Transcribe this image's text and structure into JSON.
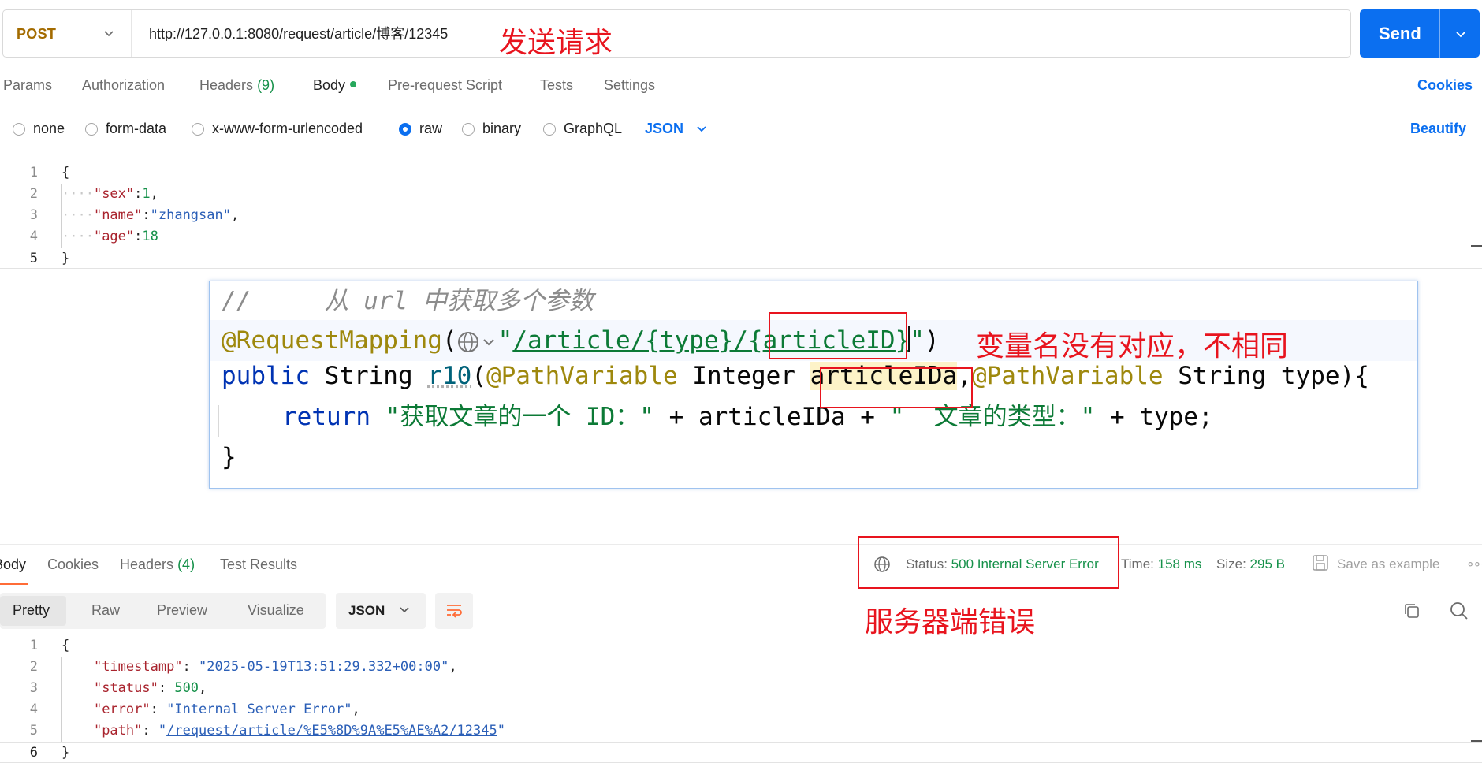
{
  "request": {
    "method": "POST",
    "url": "http://127.0.0.1:8080/request/article/博客/12345",
    "annotation": "发送请求",
    "send_label": "Send"
  },
  "request_tabs": {
    "params": "Params",
    "authorization": "Authorization",
    "headers": "Headers",
    "headers_count": "(9)",
    "body": "Body",
    "pre_request": "Pre-request Script",
    "tests": "Tests",
    "settings": "Settings",
    "cookies": "Cookies"
  },
  "body_types": {
    "none": "none",
    "form_data": "form-data",
    "urlencoded": "x-www-form-urlencoded",
    "raw": "raw",
    "binary": "binary",
    "graphql": "GraphQL",
    "selected": "raw",
    "language": "JSON",
    "beautify": "Beautify"
  },
  "request_body": {
    "line_numbers": [
      "1",
      "2",
      "3",
      "4",
      "5"
    ],
    "open_brace": "{",
    "close_brace": "}",
    "sex_key": "\"sex\"",
    "sex_val": "1",
    "name_key": "\"name\"",
    "name_val": "\"zhangsan\"",
    "age_key": "\"age\"",
    "age_val": "18"
  },
  "code_overlay": {
    "comment": "//     从 url 中获取多个参数",
    "annotation_name": "@RequestMapping",
    "mapping_path_prefix": "/article/{type}/{",
    "mapping_path_var": "articleID",
    "mapping_path_suffix": "}",
    "kw_public": "public",
    "type_string": "String",
    "method_name": "r10",
    "path_variable": "@PathVariable",
    "type_integer": "Integer",
    "param_articleIDa": "articleIDa",
    "param_type": "type",
    "kw_return": "return",
    "return_str1": "\"获取文章的一个 ID：\"",
    "return_var1": "articleIDa",
    "return_str2": "\"  文章的类型：\"",
    "return_var2": "type",
    "close": "}",
    "annotation": "变量名没有对应，不相同"
  },
  "response_tabs": {
    "body": "Body",
    "cookies": "Cookies",
    "headers": "Headers",
    "headers_count": "(4)",
    "test_results": "Test Results"
  },
  "response_meta": {
    "status_label": "Status:",
    "status_value": "500 Internal Server Error",
    "time_label": "Time:",
    "time_value": "158 ms",
    "size_label": "Size:",
    "size_value": "295 B",
    "save_example": "Save as example",
    "annotation": "服务器端错误"
  },
  "view_modes": {
    "pretty": "Pretty",
    "raw": "Raw",
    "preview": "Preview",
    "visualize": "Visualize",
    "format": "JSON"
  },
  "response_body": {
    "line_numbers": [
      "1",
      "2",
      "3",
      "4",
      "5",
      "6"
    ],
    "open_brace": "{",
    "close_brace": "}",
    "timestamp_key": "\"timestamp\"",
    "timestamp_val": "\"2025-05-19T13:51:29.332+00:00\"",
    "status_key": "\"status\"",
    "status_val": "500",
    "error_key": "\"error\"",
    "error_val": "\"Internal Server Error\"",
    "path_key": "\"path\"",
    "path_val_url": "/request/article/%E5%8D%9A%E5%AE%A2/12345"
  },
  "colors": {
    "accent": "#0b6ff0",
    "method": "#a36b00",
    "annotation_red": "#e8141e",
    "success_green": "#16914a"
  }
}
